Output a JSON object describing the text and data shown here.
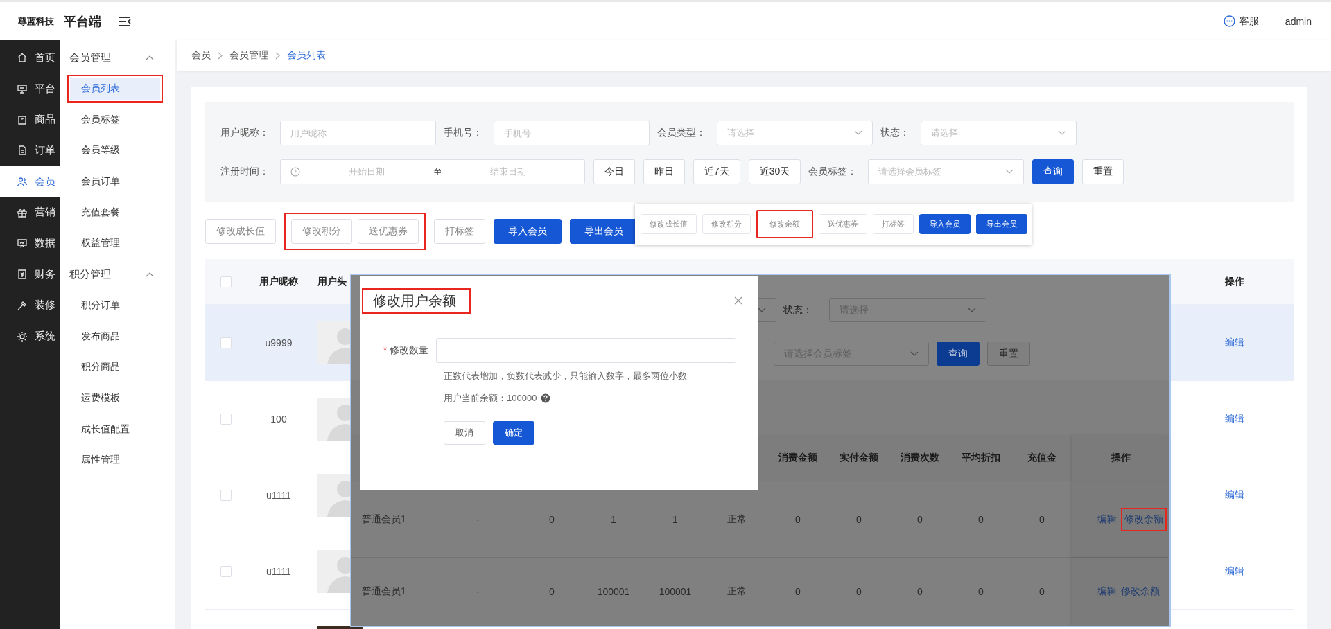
{
  "header": {
    "brand": "尊蓝科技",
    "app_name": "平台端",
    "service_label": "客服",
    "user": "admin"
  },
  "nav": [
    {
      "label": "首页",
      "selected": false
    },
    {
      "label": "平台",
      "selected": false
    },
    {
      "label": "商品",
      "selected": false
    },
    {
      "label": "订单",
      "selected": false
    },
    {
      "label": "会员",
      "selected": true
    },
    {
      "label": "营销",
      "selected": false
    },
    {
      "label": "数据",
      "selected": false
    },
    {
      "label": "财务",
      "selected": false
    },
    {
      "label": "装修",
      "selected": false
    },
    {
      "label": "系统",
      "selected": false
    }
  ],
  "subnav": [
    {
      "label": "会员管理",
      "expanded": true,
      "children": [
        {
          "label": "会员列表",
          "selected": true,
          "highlighted": true
        },
        {
          "label": "会员标签",
          "selected": false,
          "highlighted": false
        },
        {
          "label": "会员等级",
          "selected": false,
          "highlighted": false
        },
        {
          "label": "会员订单",
          "selected": false,
          "highlighted": false
        },
        {
          "label": "充值套餐",
          "selected": false,
          "highlighted": false
        },
        {
          "label": "权益管理",
          "selected": false,
          "highlighted": false
        }
      ]
    },
    {
      "label": "积分管理",
      "expanded": true,
      "children": [
        {
          "label": "积分订单",
          "selected": false,
          "highlighted": false
        },
        {
          "label": "发布商品",
          "selected": false,
          "highlighted": false
        },
        {
          "label": "积分商品",
          "selected": false,
          "highlighted": false
        },
        {
          "label": "运费模板",
          "selected": false,
          "highlighted": false
        },
        {
          "label": "成长值配置",
          "selected": false,
          "highlighted": false
        },
        {
          "label": "属性管理",
          "selected": false,
          "highlighted": false
        }
      ]
    }
  ],
  "breadcrumb": [
    {
      "label": "会员",
      "selected": false
    },
    {
      "label": "会员管理",
      "selected": false
    },
    {
      "label": "会员列表",
      "selected": true
    }
  ],
  "filters": [
    [
      {
        "kind": "input",
        "label": "用户昵称：",
        "placeholder": "用户昵称"
      },
      {
        "kind": "input",
        "label": "手机号：",
        "placeholder": "手机号"
      },
      {
        "kind": "select",
        "label": "会员类型：",
        "placeholder": "请选择"
      },
      {
        "kind": "select",
        "label": "状态：",
        "placeholder": "请选择"
      }
    ],
    [
      {
        "kind": "daterange",
        "label": "注册时间：",
        "start_placeholder": "开始日期",
        "separator": "至",
        "end_placeholder": "结束日期"
      },
      {
        "kind": "button",
        "label": "今日"
      },
      {
        "kind": "button",
        "label": "昨日"
      },
      {
        "kind": "button",
        "label": "近7天"
      },
      {
        "kind": "button",
        "label": "近30天"
      },
      {
        "kind": "select",
        "label": "会员标签：",
        "placeholder": "请选择会员标签"
      },
      {
        "kind": "primary_button",
        "label": "查询"
      },
      {
        "kind": "button",
        "label": "重置"
      }
    ]
  ],
  "toolbar": [
    {
      "label": "修改成长值",
      "kind": "button",
      "highlighted": false
    },
    {
      "label": "修改积分",
      "kind": "button",
      "highlighted": true
    },
    {
      "label": "送优惠券",
      "kind": "button",
      "highlighted": true
    },
    {
      "label": "打标签",
      "kind": "button",
      "highlighted": false
    },
    {
      "label": "导入会员",
      "kind": "primary_button",
      "highlighted": false
    },
    {
      "label": "导出会员",
      "kind": "primary_button",
      "highlighted": false
    }
  ],
  "table": {
    "select_all_checked": false,
    "columns": [
      "用户昵称",
      "用户头",
      "操作"
    ],
    "rows": [
      {
        "nickname": "u9999",
        "avatar": {
          "kind": "silhouette"
        },
        "action": "编辑",
        "checked": false,
        "selected": true
      },
      {
        "nickname": "100",
        "avatar": {
          "kind": "silhouette"
        },
        "action": "编辑",
        "checked": false,
        "selected": false
      },
      {
        "nickname": "u1111",
        "avatar": {
          "kind": "silhouette"
        },
        "action": "编辑",
        "checked": false,
        "selected": false
      },
      {
        "nickname": "u1111",
        "avatar": {
          "kind": "silhouette"
        },
        "action": "编辑",
        "checked": false,
        "selected": false
      },
      {
        "selected": false
      }
    ]
  },
  "popup_toolbar": [
    {
      "label": "修改成长值",
      "kind": "button",
      "highlighted": false
    },
    {
      "label": "修改积分",
      "kind": "button",
      "highlighted": false
    },
    {
      "label": "修改余额",
      "kind": "button",
      "highlighted": true
    },
    {
      "label": "送优惠券",
      "kind": "button",
      "highlighted": false
    },
    {
      "label": "打标签",
      "kind": "button",
      "highlighted": false
    },
    {
      "label": "导入会员",
      "kind": "primary_button",
      "highlighted": false
    },
    {
      "label": "导出会员",
      "kind": "primary_button",
      "highlighted": false
    }
  ],
  "screenshot": {
    "filters": {
      "status_label": "状态：",
      "status_placeholder": "请选择",
      "tag_placeholder": "请选择会员标签",
      "query": "查询",
      "reset": "重置"
    },
    "header": {
      "metrics": [
        "消费金额",
        "实付金额",
        "消费次数",
        "平均折扣",
        "充值金"
      ],
      "actions": "操作"
    },
    "rows": [
      {
        "cells": [
          "普通会员1",
          "-",
          "0",
          "1",
          "1",
          "正常",
          "0",
          "0",
          "0",
          "0",
          "0"
        ],
        "actions": [
          {
            "label": "编辑",
            "highlighted": false
          },
          {
            "label": "修改余额",
            "highlighted": true
          }
        ]
      },
      {
        "cells": [
          "普通会员1",
          "-",
          "0",
          "100001",
          "100001",
          "正常",
          "0",
          "0",
          "0",
          "0",
          "0"
        ],
        "actions": [
          {
            "label": "编辑",
            "highlighted": false
          },
          {
            "label": "修改余额",
            "highlighted": false
          }
        ]
      }
    ]
  },
  "modal": {
    "title": "修改用户余额",
    "title_highlighted": true,
    "required_mark": "*",
    "field_label": "修改数量",
    "hint": "正数代表增加，负数代表减少，只能输入数字，最多两位小数",
    "balance_text": "用户当前余额：100000",
    "buttons": [
      {
        "label": "取消",
        "kind": "button"
      },
      {
        "label": "确定",
        "kind": "primary_button"
      }
    ]
  }
}
